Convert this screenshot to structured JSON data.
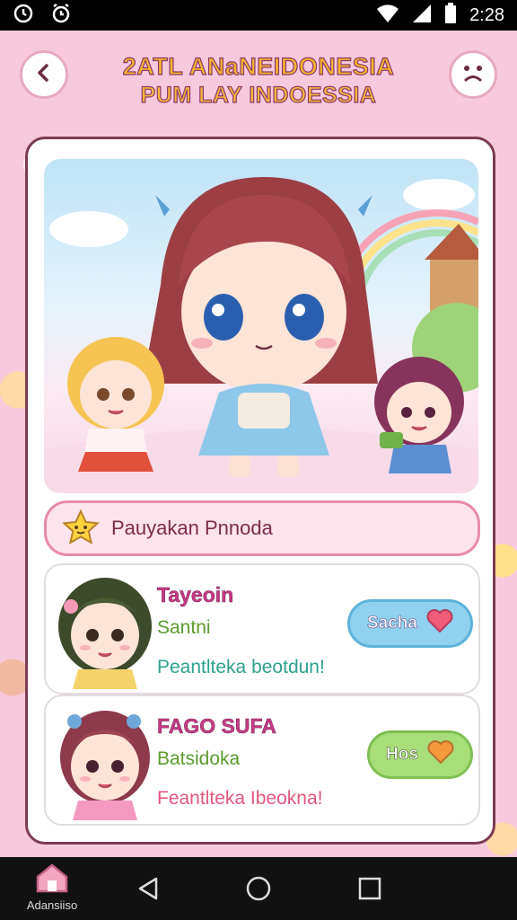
{
  "status_bar": {
    "time": "2:28",
    "icons": [
      "clock-icon",
      "alarm-icon",
      "wifi-icon",
      "signal-icon",
      "battery-icon"
    ]
  },
  "header": {
    "title_line1": "2ATL ANaNEIDONESIA",
    "title_line2": "PUM LAY INDOESSIA",
    "back_icon": "back-chevron-icon",
    "face_icon": "sad-face-icon"
  },
  "search": {
    "icon": "star-icon",
    "text": "Pauyakan Pnnoda"
  },
  "list": [
    {
      "name": "Tayeoin",
      "sub": "Santni",
      "desc": "Peantlteka beotdun!",
      "action_label": "Sacha",
      "action_icon": "heart-icon"
    },
    {
      "name": "FAGO SUFA",
      "sub": "Batsidoka",
      "desc": "Feantlteka Ibeokna!",
      "action_label": "Hos",
      "action_icon": "heart-icon"
    }
  ],
  "nav": {
    "home_label": "Adansiiso",
    "home_icon": "home-icon",
    "back_icon": "triangle-back-icon",
    "circle_icon": "circle-home-icon",
    "square_icon": "square-recents-icon"
  },
  "colors": {
    "background": "#f7c9dc",
    "card_border": "#7c3b52",
    "accent_pink": "#e98aa8",
    "pill_blue": "#8fd1ee",
    "pill_green": "#a7de7a"
  }
}
